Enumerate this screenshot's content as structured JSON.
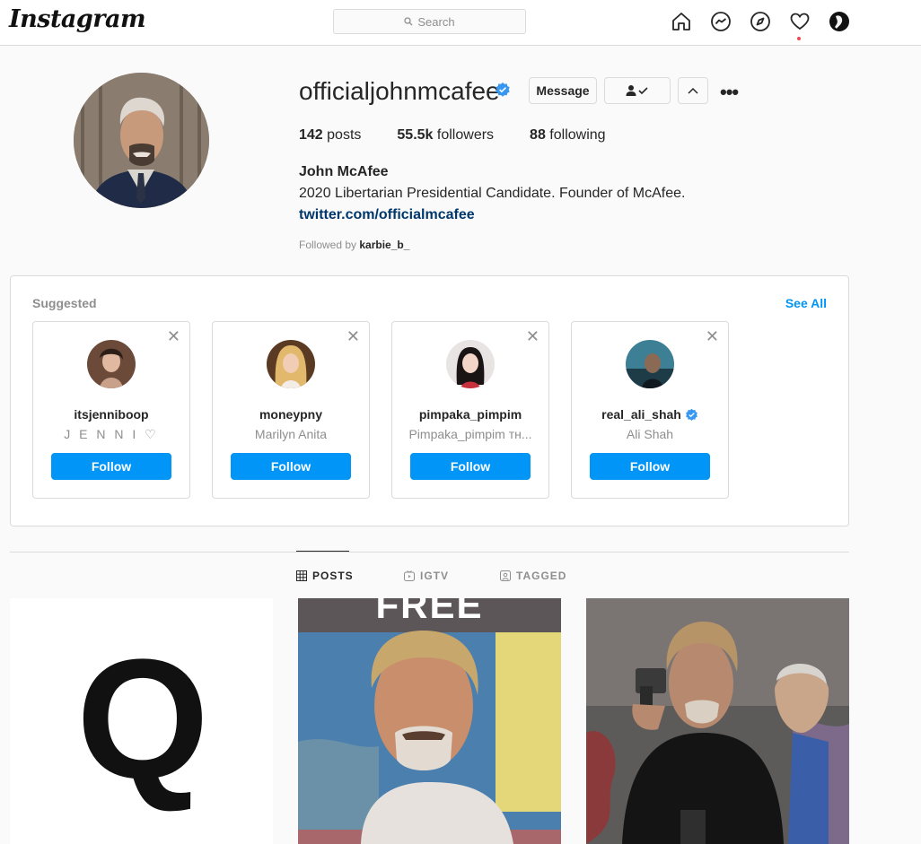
{
  "nav": {
    "logo": "Instagram",
    "search_placeholder": "Search",
    "icons": [
      "home-icon",
      "messenger-icon",
      "explore-icon",
      "activity-heart-icon",
      "profile-avatar-icon"
    ]
  },
  "profile": {
    "username": "officialjohnmcafee",
    "verified": true,
    "message_label": "Message",
    "stats": {
      "posts_count": "142",
      "posts_label": "posts",
      "followers_count": "55.5k",
      "followers_label": "followers",
      "following_count": "88",
      "following_label": "following"
    },
    "full_name": "John McAfee",
    "bio": "2020 Libertarian Presidential Candidate. Founder of McAfee.",
    "link": "twitter.com/officialmcafee",
    "followed_by_label": "Followed by",
    "followed_by_user": "karbie_b_"
  },
  "suggested": {
    "title": "Suggested",
    "see_all": "See All",
    "cards": [
      {
        "username": "itsjenniboop",
        "subtitle": "J E N N I ♡",
        "verified": false,
        "follow": "Follow"
      },
      {
        "username": "moneypny",
        "subtitle": "Marilyn Anita",
        "verified": false,
        "follow": "Follow"
      },
      {
        "username": "pimpaka_pimpim",
        "subtitle": "Pimpaka_pimpim тн...",
        "verified": false,
        "follow": "Follow"
      },
      {
        "username": "real_ali_shah",
        "subtitle": "Ali Shah",
        "verified": true,
        "follow": "Follow"
      }
    ]
  },
  "tabs": [
    {
      "label": "POSTS",
      "active": true
    },
    {
      "label": "IGTV",
      "active": false
    },
    {
      "label": "TAGGED",
      "active": false
    }
  ],
  "posts": {
    "post1_letter": "Q",
    "post2_caption": "FREE"
  },
  "colors": {
    "accent_blue": "#0095f6",
    "link_blue": "#00376b",
    "verified_blue": "#3897f0",
    "border": "#dbdbdb",
    "notification_red": "#ed4956"
  }
}
